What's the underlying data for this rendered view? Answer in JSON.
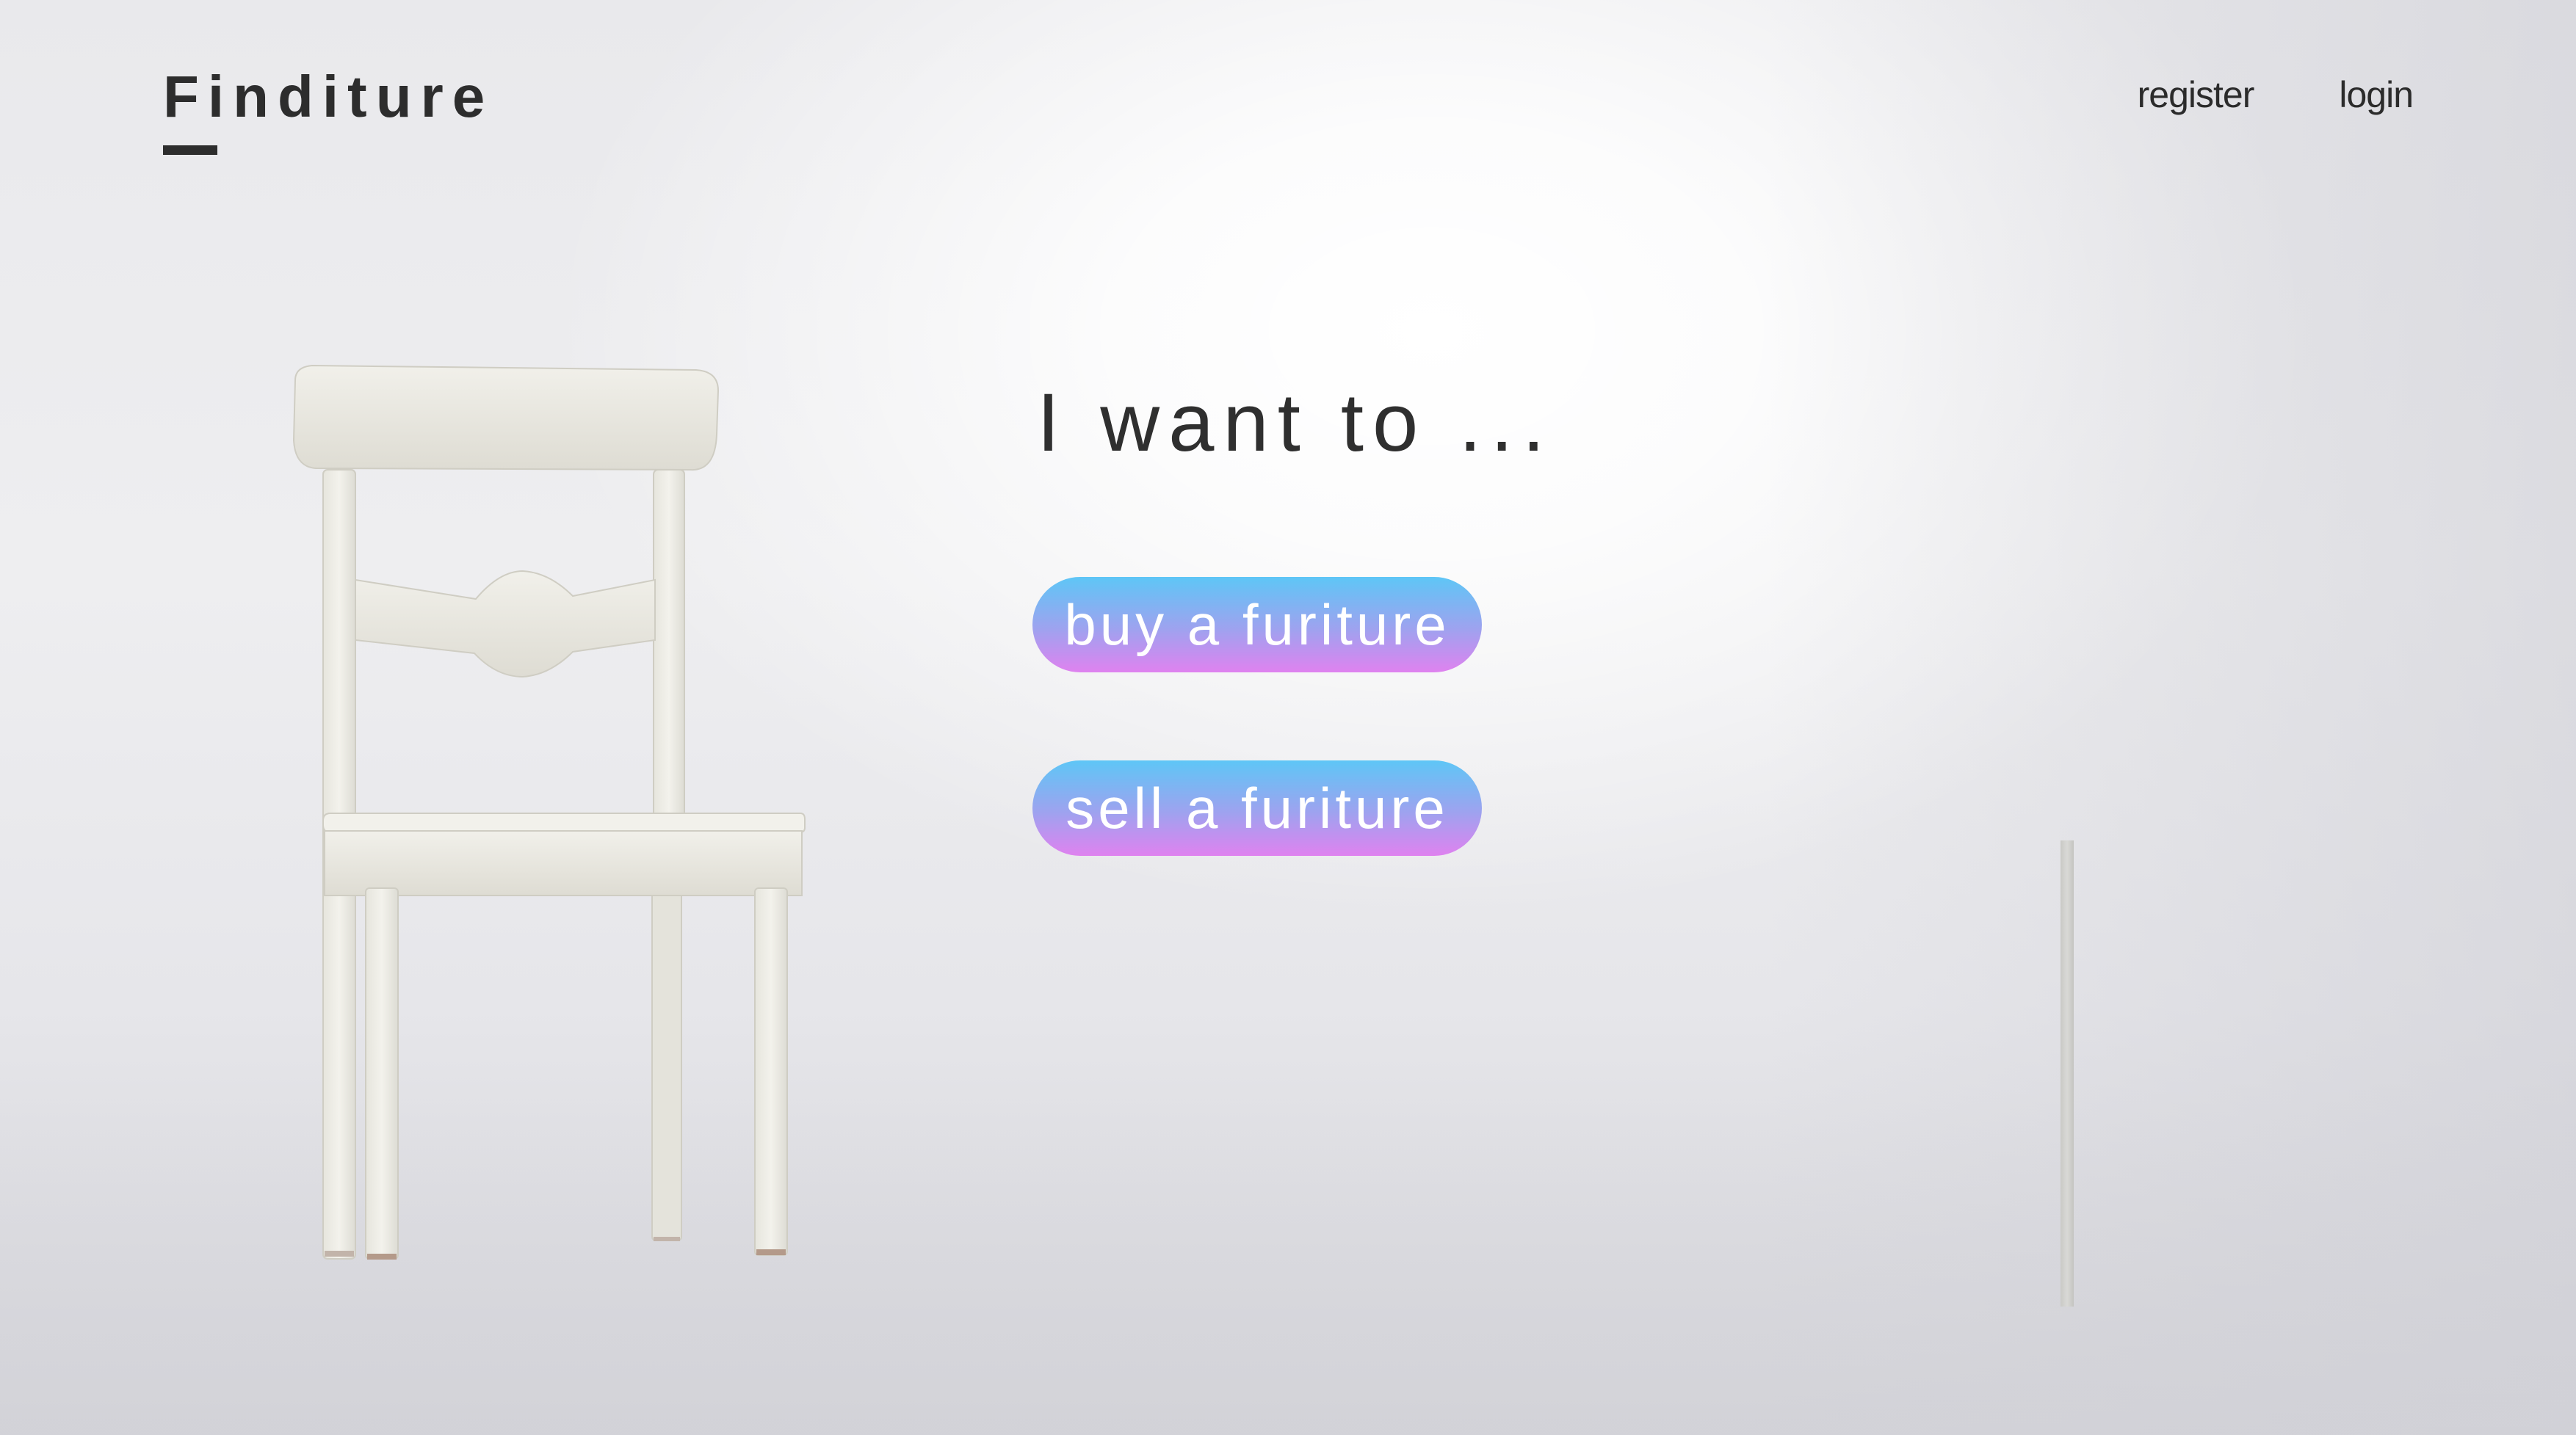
{
  "brand": {
    "name": "Finditure"
  },
  "nav": {
    "register_label": "register",
    "login_label": "login"
  },
  "hero": {
    "headline": "I want to ...",
    "buy_label": "buy a furiture",
    "sell_label": "sell a furiture"
  },
  "icons": {
    "chair_image": "white-wooden-chair",
    "pole": "standing-pole"
  },
  "colors": {
    "text_dark": "#2d2d2d",
    "button_gradient_top": "#5ec6f6",
    "button_gradient_bottom": "#df82ef",
    "button_text": "#ffffff",
    "background": "#ececef"
  }
}
